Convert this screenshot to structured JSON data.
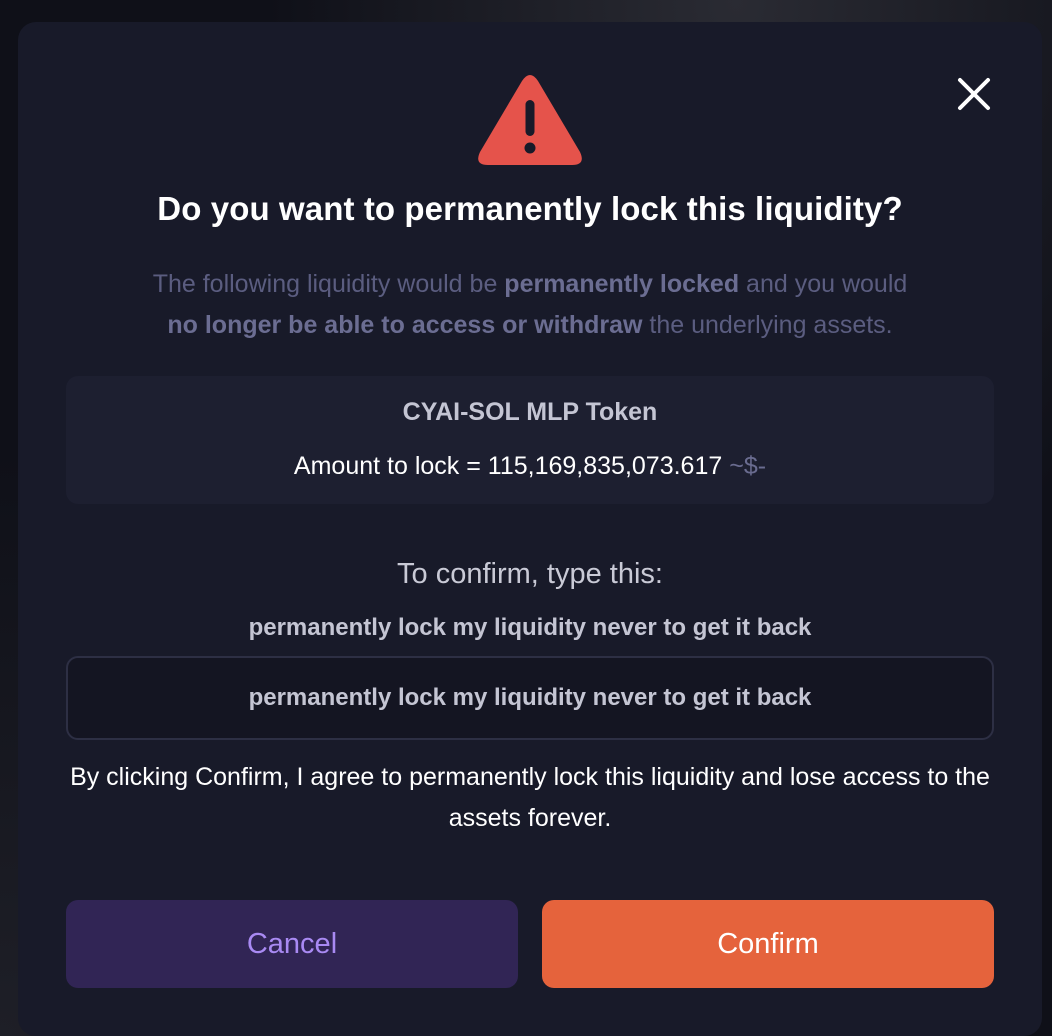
{
  "modal": {
    "title": "Do you want to permanently lock this liquidity?",
    "description": {
      "part1": "The following liquidity would be ",
      "bold1": "permanently locked",
      "part2": " and you would ",
      "bold2": "no longer be able to access or withdraw",
      "part3": " the underlying assets."
    },
    "token": {
      "name": "CYAI-SOL MLP Token",
      "amount_label": "Amount to lock = ",
      "amount_value": "115,169,835,073.617",
      "usd_value": "~$-"
    },
    "confirm_prompt": "To confirm, type this:",
    "confirm_phrase": "permanently lock my liquidity never to get it back",
    "input": {
      "value": "permanently lock my liquidity never to get it back"
    },
    "agreement": "By clicking Confirm, I agree to permanently lock this liquidity and lose access to the assets forever.",
    "buttons": {
      "cancel": "Cancel",
      "confirm": "Confirm"
    },
    "icons": {
      "warning": "warning-triangle-icon",
      "close": "close-icon"
    },
    "colors": {
      "warning": "#e5534b",
      "confirm": "#e5633c",
      "cancel_bg": "#312555",
      "cancel_text": "#a98af3"
    }
  }
}
